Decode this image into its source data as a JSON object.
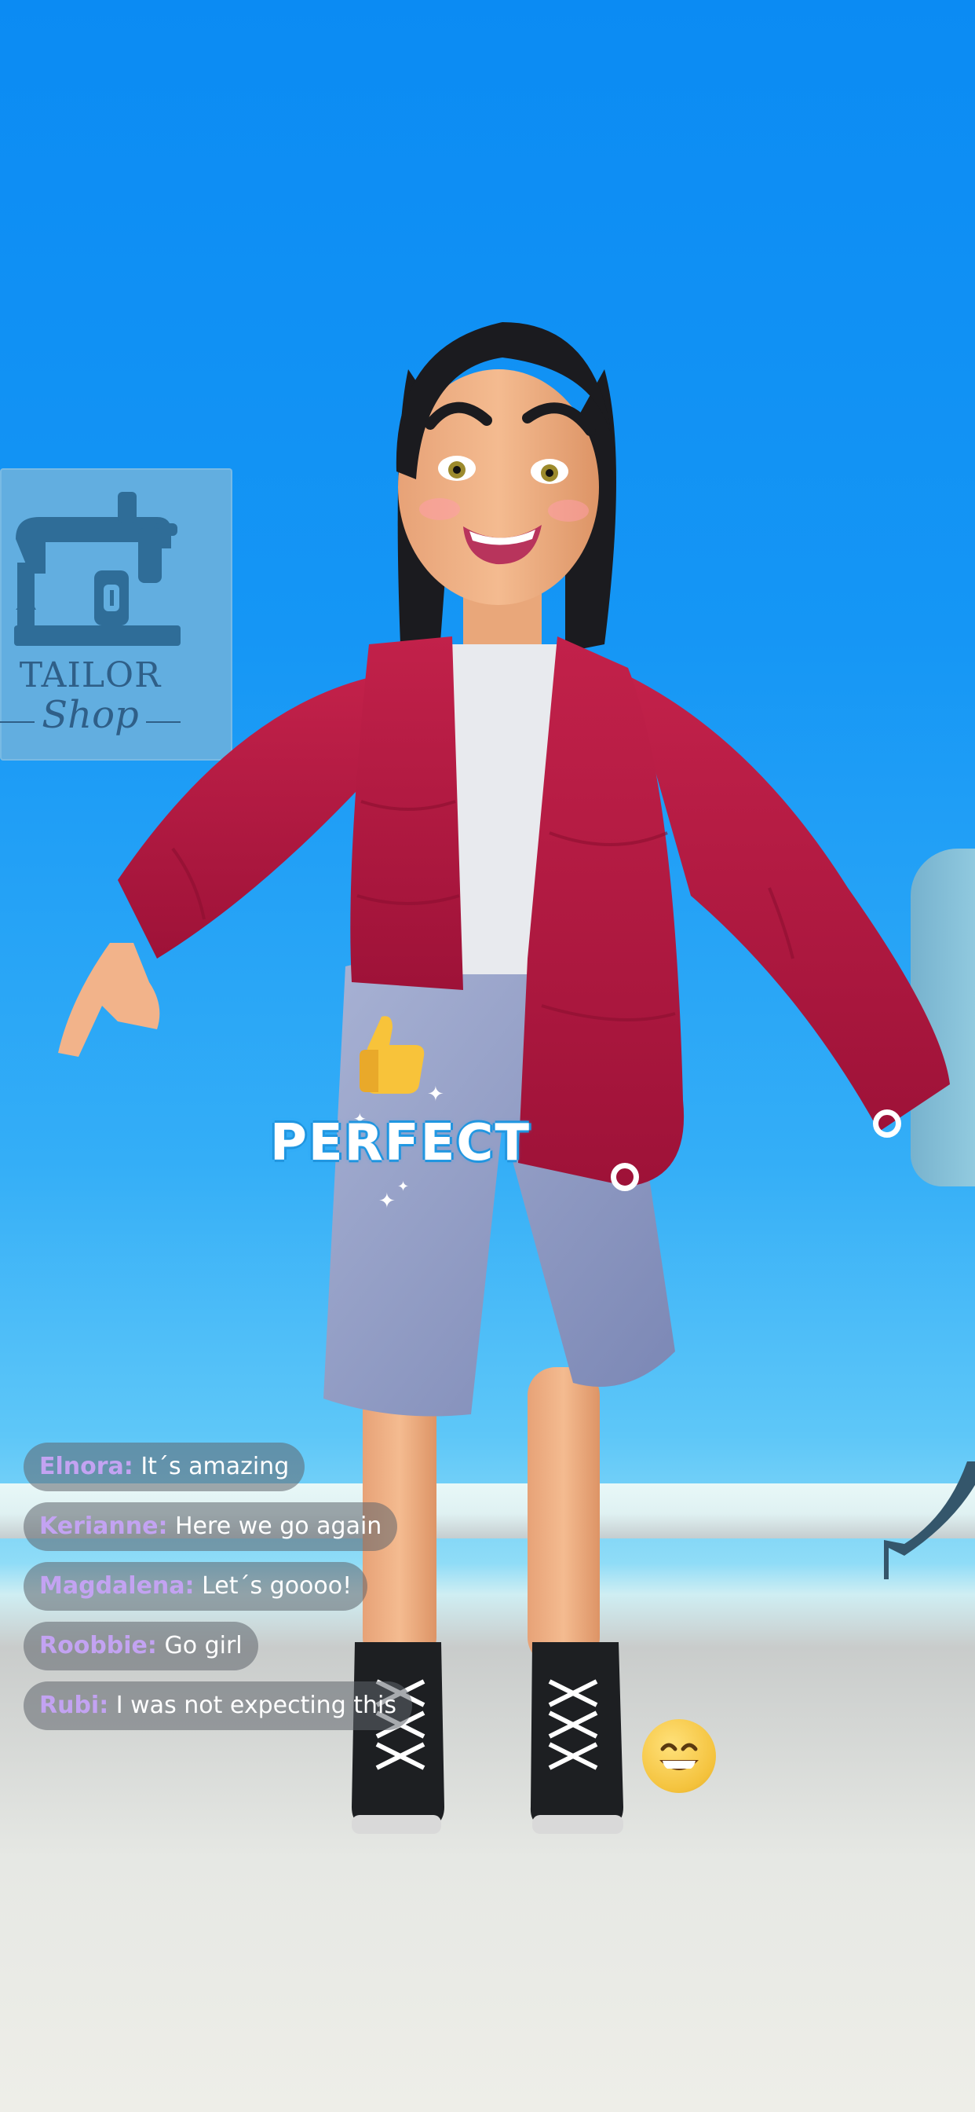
{
  "scene": {
    "sign": {
      "line1": "TAILOR",
      "line2": "Shop"
    }
  },
  "feedback": {
    "label": "PERFECT",
    "icon": "thumbs-up-icon"
  },
  "chat": {
    "messages": [
      {
        "name": "Elnora:",
        "text": "It´s amazing"
      },
      {
        "name": "Kerianne:",
        "text": "Here we go again"
      },
      {
        "name": "Magdalena:",
        "text": "Let´s goooo!"
      },
      {
        "name": "Roobbie:",
        "text": "Go girl"
      },
      {
        "name": "Rubi:",
        "text": "I was not expecting this"
      }
    ]
  },
  "emoji_button": {
    "icon": "grinning-face-icon"
  },
  "colors": {
    "sky": "#1596f5",
    "jacket": "#b3163f",
    "jeans": "#8e9ac4",
    "chat_name": "#c3a3f2",
    "perfect_outline": "#1f8fd8"
  }
}
